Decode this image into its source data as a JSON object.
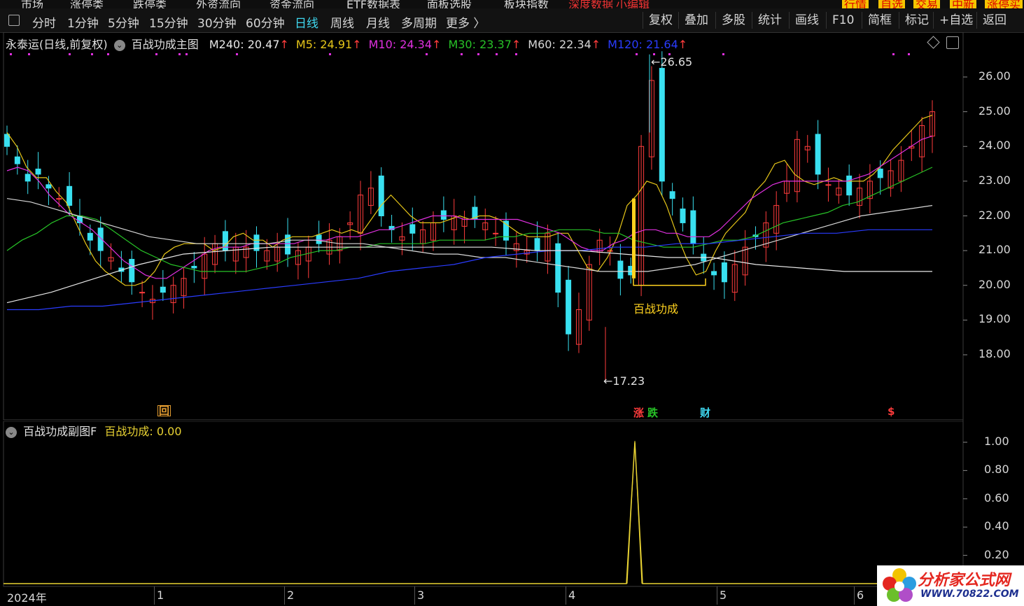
{
  "top_menu": {
    "items": [
      "市场",
      "涨停类",
      "跌停类",
      "外资流向",
      "资金流向",
      "ETF数据表",
      "面板选股",
      "板块指数"
    ],
    "red_items": [
      "深度数据",
      "小编辑"
    ],
    "right_buttons": [
      "行情",
      "自选",
      "交易",
      "中新",
      "涨停买"
    ]
  },
  "toolbar": {
    "periods": [
      "分时",
      "1分钟",
      "5分钟",
      "15分钟",
      "30分钟",
      "60分钟",
      "日线",
      "周线",
      "月线",
      "多周期",
      "更多 〉"
    ],
    "active_period": "日线",
    "right_tools": [
      "复权",
      "叠加",
      "多股",
      "统计",
      "画线",
      "F10",
      "简框",
      "标记",
      "+自选",
      "返回"
    ]
  },
  "main_legend": {
    "stock": "永泰运(日线,前复权)",
    "indicator": "百战功成主图",
    "ma": [
      {
        "label": "M240: 20.47",
        "color": "#e8e8e8"
      },
      {
        "label": "M5: 24.91",
        "color": "#e6c619"
      },
      {
        "label": "M10: 24.34",
        "color": "#e030e0"
      },
      {
        "label": "M30: 23.37",
        "color": "#27c227"
      },
      {
        "label": "M60: 22.34",
        "color": "#d8d8d8"
      },
      {
        "label": "M120: 21.64",
        "color": "#2a3cff"
      }
    ],
    "arrow": "↑"
  },
  "sub_legend": {
    "indicator": "百战功成副图F",
    "value_label": "百战功成: 0.00"
  },
  "colors": {
    "up": "#ff3c3c",
    "down": "#39e0f0",
    "m5": "#e6c619",
    "m10": "#e030e0",
    "m30": "#27c227",
    "m60": "#d8d8d8",
    "m120": "#2a3cff",
    "signal": "#ffd21f",
    "sub_line": "#e8d233"
  },
  "main_axis": {
    "labels": [
      "26.00",
      "25.00",
      "24.00",
      "23.00",
      "22.00",
      "21.00",
      "20.00",
      "19.00",
      "18.00"
    ]
  },
  "sub_axis": {
    "labels": [
      "1.00",
      "0.80",
      "0.60",
      "0.40",
      "0.20"
    ]
  },
  "x_axis": {
    "labels": [
      "2024年",
      "1",
      "2",
      "3",
      "4",
      "5",
      "6"
    ]
  },
  "annotations": {
    "high": "26.65",
    "low": "17.23",
    "signal_text": "百战功成",
    "high_arrow": "←",
    "low_arrow": "←",
    "marker_hui": "回",
    "marker_zhang": "涨",
    "marker_die": "跌",
    "marker_cai": "财",
    "marker_s": "$"
  },
  "watermark": {
    "title": "分析家公式网",
    "url": "WWW.70822.COM"
  },
  "chart_data": {
    "type": "line",
    "x_count": 130,
    "series": [
      {
        "name": "M5",
        "values": [
          24.4,
          24.0,
          23.4,
          23.1,
          23.1,
          22.7,
          22.4,
          21.8,
          21.2,
          20.7,
          20.4,
          20.2,
          20.0,
          20.0,
          20.1,
          20.4,
          20.9,
          21.1,
          21.2,
          21.2,
          21.2,
          21.0,
          21.1,
          21.4,
          21.5,
          21.3,
          21.3,
          21.1,
          21.3,
          21.4,
          21.4,
          21.4,
          21.5,
          21.6,
          21.5,
          21.6,
          21.5,
          21.9,
          22.3,
          22.6,
          22.3,
          22.0,
          21.8,
          21.8,
          21.8,
          21.9,
          22.0,
          21.9,
          22.0,
          22.0,
          21.9,
          21.7,
          21.5,
          21.4,
          21.4,
          21.4,
          21.5,
          21.5,
          21.0,
          20.5,
          20.4,
          20.8,
          21.4,
          22.3,
          22.6,
          23.0,
          22.9,
          22.3,
          21.5,
          20.8,
          20.3,
          20.4,
          21.0,
          21.5,
          21.8,
          22.1,
          22.7,
          23.0,
          23.5,
          23.6,
          23.2,
          23.0,
          22.9,
          23.0,
          23.1,
          23.0,
          23.0,
          23.0,
          23.2,
          23.5,
          23.9,
          24.2,
          24.5,
          24.8,
          24.9
        ]
      },
      {
        "name": "M10",
        "values": [
          23.3,
          23.4,
          23.3,
          23.0,
          22.6,
          22.3,
          22.0,
          21.8,
          21.6,
          21.3,
          21.0,
          20.7,
          20.5,
          20.3,
          20.2,
          20.2,
          20.4,
          20.6,
          20.8,
          21.0,
          21.1,
          21.1,
          21.1,
          21.2,
          21.2,
          21.2,
          21.2,
          21.2,
          21.3,
          21.3,
          21.3,
          21.4,
          21.4,
          21.4,
          21.5,
          21.6,
          21.6,
          21.7,
          21.8,
          21.9,
          22.0,
          22.0,
          22.0,
          21.9,
          21.9,
          21.9,
          21.9,
          21.9,
          21.9,
          21.8,
          21.7,
          21.6,
          21.5,
          21.3,
          21.1,
          21.0,
          21.0,
          21.2,
          21.3,
          21.5,
          21.6,
          21.6,
          21.5,
          21.5,
          21.4,
          21.4,
          21.4,
          21.6,
          21.9,
          22.2,
          22.5,
          22.7,
          22.9,
          23.0,
          23.0,
          23.0,
          23.0,
          23.0,
          23.0,
          23.0,
          23.1,
          23.2,
          23.4,
          23.6,
          23.8,
          24.0,
          24.2,
          24.3
        ]
      },
      {
        "name": "M30",
        "values": [
          21.0,
          21.3,
          21.5,
          21.8,
          22.0,
          22.0,
          21.9,
          21.6,
          21.3,
          21.0,
          20.8,
          20.6,
          20.5,
          20.4,
          20.4,
          20.4,
          20.4,
          20.5,
          20.6,
          20.8,
          20.9,
          21.0,
          21.0,
          21.1,
          21.1,
          21.2,
          21.2,
          21.2,
          21.2,
          21.3,
          21.3,
          21.3,
          21.3,
          21.4,
          21.4,
          21.5,
          21.5,
          21.6,
          21.6,
          21.6,
          21.5,
          21.5,
          21.3,
          21.2,
          21.1,
          21.1,
          21.1,
          21.2,
          21.3,
          21.3,
          21.4,
          21.6,
          21.8,
          21.9,
          22.0,
          22.1,
          22.3,
          22.4,
          22.6,
          22.8,
          23.0,
          23.2,
          23.4
        ]
      },
      {
        "name": "M60",
        "values": [
          22.5,
          22.4,
          22.2,
          22.0,
          21.8,
          21.6,
          21.4,
          21.3,
          21.2,
          21.2,
          21.2,
          21.2,
          21.3,
          21.3,
          21.2,
          21.2,
          21.1,
          21.0,
          20.9,
          20.9,
          20.8,
          20.8,
          20.7,
          20.6,
          20.5,
          20.4,
          20.4,
          20.4,
          20.5,
          20.6,
          20.8,
          21.0,
          21.2,
          21.4,
          21.6,
          21.8,
          22.0,
          22.1,
          22.2,
          22.3
        ]
      },
      {
        "name": "M120",
        "values": [
          19.3,
          19.3,
          19.4,
          19.4,
          19.5,
          19.6,
          19.7,
          19.8,
          19.9,
          20.0,
          20.1,
          20.2,
          20.4,
          20.5,
          20.6,
          20.8,
          20.9,
          21.0,
          21.0,
          21.1,
          21.1,
          21.2,
          21.2,
          21.3,
          21.4,
          21.5,
          21.5,
          21.6,
          21.6,
          21.6
        ]
      },
      {
        "name": "M240",
        "values": [
          19.5,
          19.8,
          20.2,
          20.6,
          20.9,
          21.0,
          21.1,
          21.1,
          21.1,
          21.1,
          21.1,
          21.1,
          21.0,
          21.0,
          20.9,
          20.8,
          20.8,
          20.6,
          20.5,
          20.4,
          20.4,
          20.4
        ]
      }
    ],
    "high": 26.65,
    "low": 17.23,
    "ylim": [
      17.0,
      27.0
    ],
    "sub_series": {
      "name": "百战功成",
      "spike_value": 1.0,
      "ylim": [
        0,
        1.1
      ]
    }
  }
}
